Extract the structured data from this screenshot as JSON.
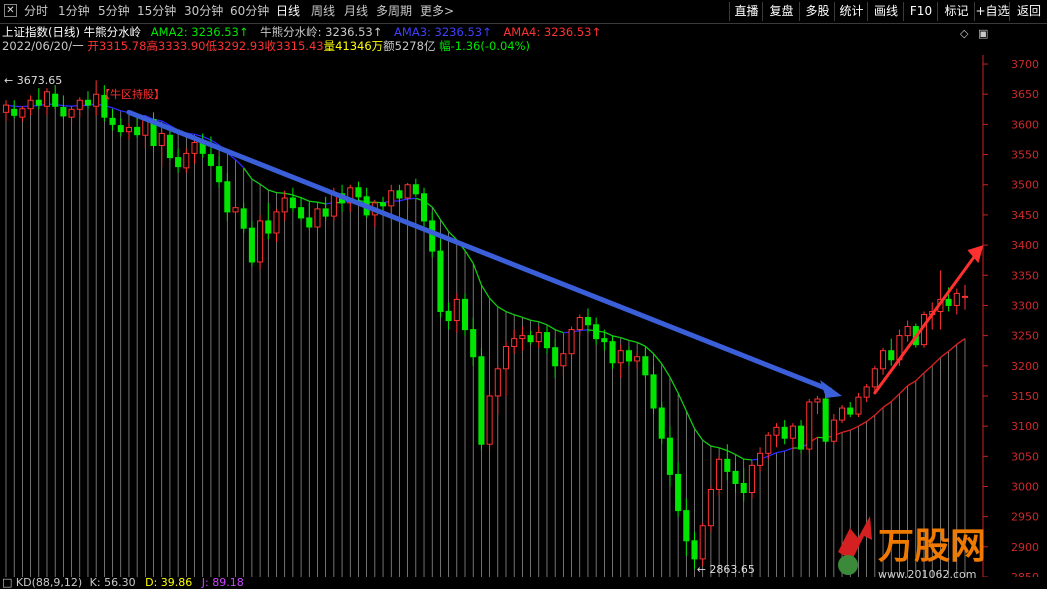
{
  "toolbar": {
    "left_items": [
      "分时",
      "1分钟",
      "5分钟",
      "15分钟",
      "30分钟",
      "60分钟",
      "日线",
      "周线",
      "月线",
      "多周期",
      "更多>"
    ],
    "active": "日线",
    "right_items": [
      "直播",
      "复盘",
      "多股",
      "统计",
      "画线",
      "F10",
      "标记",
      "+自选",
      "返回"
    ]
  },
  "info": {
    "title": "上证指数(日线)",
    "indicator": "牛熊分水岭",
    "ama2": "AMA2: 3236.53↑",
    "indicator2": "牛熊分水岭: 3236.53↑",
    "ama3": "AMA3: 3236.53↑",
    "ama4": "AMA4: 3236.53↑",
    "date": "2022/06/20/一",
    "open": "开3315.78",
    "high": "高3333.90",
    "low": "低3292.93",
    "close": "收3315.43",
    "volume": "量41346万",
    "amount": "额5278亿",
    "change": "幅-1.36(-0.04%)"
  },
  "annotations": {
    "high_label": "3673.65",
    "low_label": "2863.65",
    "signal_label": "【牛区持股】"
  },
  "kd": {
    "name": "KD(88,9,12)",
    "k": "K: 56.30",
    "d": "D: 39.86",
    "j": "J: 89.18"
  },
  "watermark": {
    "brand": "万股网",
    "url": "www.201062.com"
  },
  "colors": {
    "up": "#ff3232",
    "down": "#00e600",
    "axis": "#cc2222",
    "ama_line": "#2a2aff",
    "bull_line": "#e02020",
    "bear_line": "#00cc00",
    "trend_arrow": "#3a5fd9"
  },
  "chart_data": {
    "type": "candlestick",
    "title": "上证指数(日线)",
    "y_ticks": [
      3700,
      3650,
      3600,
      3550,
      3500,
      3450,
      3400,
      3350,
      3300,
      3250,
      3200,
      3150,
      3100,
      3050,
      3000,
      2950,
      2900,
      2850
    ],
    "ylim": [
      2850,
      3715
    ],
    "candles": [
      [
        3620,
        3640,
        3605,
        3632
      ],
      [
        3625,
        3640,
        3610,
        3615
      ],
      [
        3612,
        3630,
        3605,
        3626
      ],
      [
        3626,
        3648,
        3615,
        3640
      ],
      [
        3640,
        3660,
        3625,
        3632
      ],
      [
        3630,
        3660,
        3615,
        3654
      ],
      [
        3650,
        3665,
        3625,
        3630
      ],
      [
        3628,
        3648,
        3610,
        3614
      ],
      [
        3612,
        3630,
        3600,
        3625
      ],
      [
        3625,
        3645,
        3612,
        3640
      ],
      [
        3640,
        3655,
        3625,
        3632
      ],
      [
        3630,
        3673,
        3615,
        3650
      ],
      [
        3648,
        3665,
        3605,
        3612
      ],
      [
        3610,
        3625,
        3590,
        3600
      ],
      [
        3598,
        3610,
        3580,
        3588
      ],
      [
        3588,
        3602,
        3575,
        3595
      ],
      [
        3595,
        3612,
        3578,
        3583
      ],
      [
        3582,
        3615,
        3560,
        3610
      ],
      [
        3608,
        3620,
        3560,
        3565
      ],
      [
        3565,
        3590,
        3530,
        3585
      ],
      [
        3582,
        3590,
        3540,
        3545
      ],
      [
        3545,
        3560,
        3520,
        3530
      ],
      [
        3528,
        3560,
        3520,
        3552
      ],
      [
        3552,
        3575,
        3535,
        3570
      ],
      [
        3570,
        3585,
        3545,
        3552
      ],
      [
        3550,
        3580,
        3530,
        3532
      ],
      [
        3530,
        3548,
        3495,
        3505
      ],
      [
        3505,
        3520,
        3440,
        3455
      ],
      [
        3455,
        3470,
        3440,
        3462
      ],
      [
        3460,
        3470,
        3420,
        3428
      ],
      [
        3428,
        3440,
        3365,
        3372
      ],
      [
        3372,
        3450,
        3360,
        3440
      ],
      [
        3440,
        3470,
        3410,
        3420
      ],
      [
        3420,
        3460,
        3405,
        3455
      ],
      [
        3455,
        3490,
        3440,
        3478
      ],
      [
        3478,
        3495,
        3455,
        3462
      ],
      [
        3462,
        3480,
        3440,
        3445
      ],
      [
        3445,
        3470,
        3425,
        3430
      ],
      [
        3430,
        3470,
        3420,
        3460
      ],
      [
        3460,
        3480,
        3440,
        3448
      ],
      [
        3448,
        3495,
        3440,
        3485
      ],
      [
        3485,
        3500,
        3455,
        3470
      ],
      [
        3470,
        3500,
        3455,
        3495
      ],
      [
        3495,
        3505,
        3470,
        3480
      ],
      [
        3480,
        3495,
        3445,
        3450
      ],
      [
        3450,
        3475,
        3430,
        3470
      ],
      [
        3470,
        3480,
        3450,
        3465
      ],
      [
        3465,
        3500,
        3455,
        3490
      ],
      [
        3490,
        3500,
        3470,
        3478
      ],
      [
        3478,
        3503,
        3460,
        3500
      ],
      [
        3500,
        3510,
        3480,
        3485
      ],
      [
        3485,
        3495,
        3430,
        3440
      ],
      [
        3440,
        3455,
        3380,
        3390
      ],
      [
        3390,
        3410,
        3280,
        3290
      ],
      [
        3290,
        3305,
        3260,
        3275
      ],
      [
        3275,
        3320,
        3255,
        3310
      ],
      [
        3310,
        3320,
        3250,
        3260
      ],
      [
        3260,
        3280,
        3200,
        3215
      ],
      [
        3215,
        3230,
        3060,
        3070
      ],
      [
        3070,
        3160,
        3060,
        3150
      ],
      [
        3150,
        3200,
        3120,
        3195
      ],
      [
        3195,
        3240,
        3150,
        3232
      ],
      [
        3232,
        3260,
        3220,
        3245
      ],
      [
        3245,
        3265,
        3225,
        3250
      ],
      [
        3250,
        3258,
        3235,
        3240
      ],
      [
        3240,
        3265,
        3230,
        3255
      ],
      [
        3255,
        3265,
        3220,
        3230
      ],
      [
        3230,
        3245,
        3180,
        3200
      ],
      [
        3200,
        3225,
        3185,
        3220
      ],
      [
        3220,
        3265,
        3210,
        3260
      ],
      [
        3260,
        3285,
        3250,
        3280
      ],
      [
        3280,
        3295,
        3255,
        3268
      ],
      [
        3268,
        3280,
        3235,
        3245
      ],
      [
        3245,
        3260,
        3225,
        3240
      ],
      [
        3240,
        3250,
        3195,
        3205
      ],
      [
        3205,
        3235,
        3180,
        3225
      ],
      [
        3225,
        3232,
        3200,
        3208
      ],
      [
        3208,
        3222,
        3195,
        3215
      ],
      [
        3215,
        3230,
        3180,
        3185
      ],
      [
        3185,
        3200,
        3120,
        3130
      ],
      [
        3130,
        3140,
        3070,
        3080
      ],
      [
        3080,
        3100,
        3000,
        3020
      ],
      [
        3020,
        3040,
        2950,
        2960
      ],
      [
        2960,
        2980,
        2885,
        2910
      ],
      [
        2910,
        2925,
        2863,
        2880
      ],
      [
        2880,
        2940,
        2868,
        2935
      ],
      [
        2935,
        3000,
        2925,
        2995
      ],
      [
        2995,
        3050,
        2985,
        3045
      ],
      [
        3045,
        3070,
        3010,
        3025
      ],
      [
        3025,
        3040,
        2990,
        3005
      ],
      [
        3005,
        3030,
        2975,
        2990
      ],
      [
        2990,
        3040,
        2980,
        3035
      ],
      [
        3035,
        3065,
        3025,
        3055
      ],
      [
        3055,
        3090,
        3045,
        3085
      ],
      [
        3085,
        3105,
        3065,
        3098
      ],
      [
        3098,
        3110,
        3070,
        3080
      ],
      [
        3080,
        3105,
        3060,
        3100
      ],
      [
        3100,
        3110,
        3055,
        3062
      ],
      [
        3062,
        3145,
        3055,
        3140
      ],
      [
        3140,
        3150,
        3120,
        3145
      ],
      [
        3145,
        3152,
        3070,
        3075
      ],
      [
        3075,
        3120,
        3070,
        3110
      ],
      [
        3110,
        3135,
        3105,
        3130
      ],
      [
        3130,
        3140,
        3115,
        3120
      ],
      [
        3120,
        3155,
        3115,
        3148
      ],
      [
        3148,
        3170,
        3140,
        3165
      ],
      [
        3165,
        3200,
        3155,
        3195
      ],
      [
        3195,
        3230,
        3185,
        3225
      ],
      [
        3225,
        3245,
        3200,
        3210
      ],
      [
        3210,
        3260,
        3200,
        3250
      ],
      [
        3250,
        3275,
        3240,
        3265
      ],
      [
        3265,
        3270,
        3230,
        3235
      ],
      [
        3235,
        3290,
        3230,
        3285
      ],
      [
        3285,
        3305,
        3260,
        3290
      ],
      [
        3290,
        3358,
        3260,
        3310
      ],
      [
        3310,
        3330,
        3290,
        3300
      ],
      [
        3300,
        3328,
        3285,
        3320
      ],
      [
        3315,
        3334,
        3293,
        3315
      ]
    ],
    "annotations": [
      "【牛区持股】",
      "3673.65",
      "2863.65"
    ]
  }
}
